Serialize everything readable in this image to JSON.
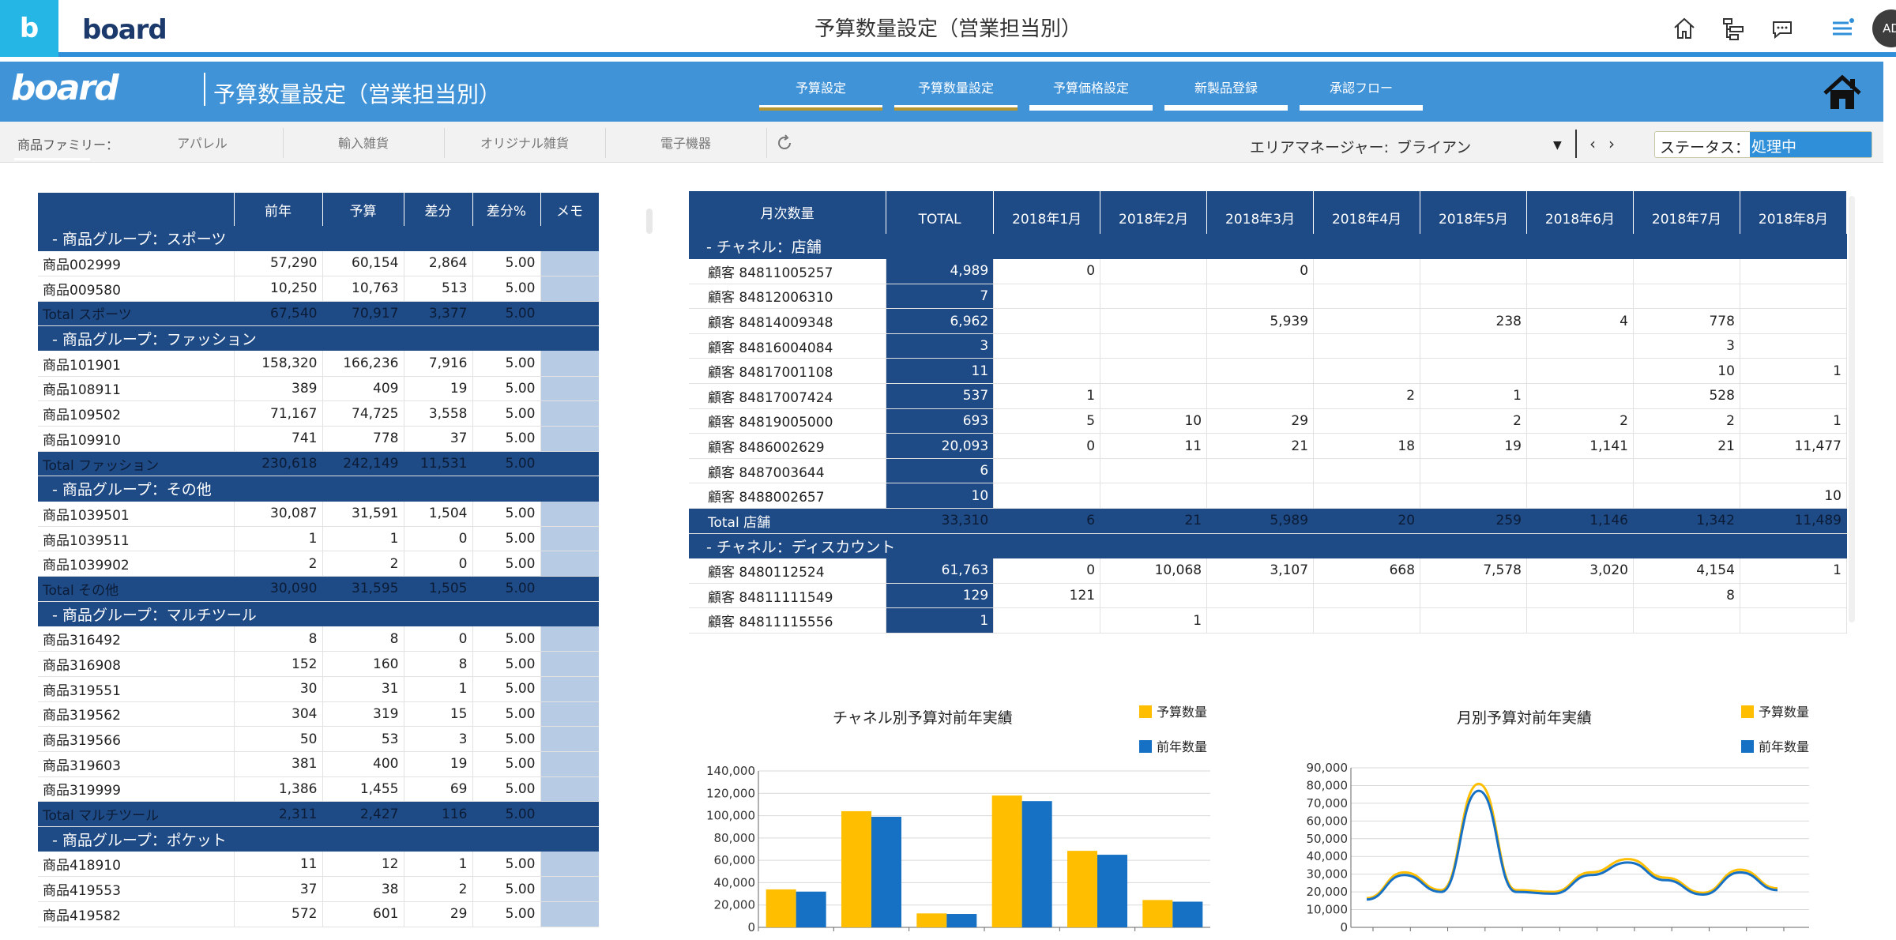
{
  "app": {
    "title": "予算数量設定（営業担当別）",
    "logo_text": "board",
    "tile_letter": "b",
    "avatar": "AD"
  },
  "header": {
    "page_title": "予算数量設定（営業担当別）",
    "logo_text": "board",
    "tabs": [
      {
        "label": "予算設定"
      },
      {
        "label": "予算数量設定"
      },
      {
        "label": "予算価格設定"
      },
      {
        "label": "新製品登録"
      },
      {
        "label": "承認フロー"
      }
    ]
  },
  "filters": {
    "family_label": "商品ファミリー：",
    "families": [
      "アパレル",
      "輸入雑貨",
      "オリジナル雑貨",
      "電子機器"
    ],
    "area_manager_label": "エリアマネージャー:",
    "area_manager_value": "ブライアン",
    "status_label": "ステータス：",
    "status_value": "処理中"
  },
  "left_grid": {
    "columns": [
      "",
      "前年",
      "予算",
      "差分",
      "差分%",
      "メモ"
    ],
    "rows": [
      {
        "type": "group",
        "label": "- 商品グループ：スポーツ"
      },
      {
        "type": "item",
        "cells": [
          "商品002999",
          "57,290",
          "60,154",
          "2,864",
          "5.00"
        ]
      },
      {
        "type": "item",
        "cells": [
          "商品009580",
          "10,250",
          "10,763",
          "513",
          "5.00"
        ]
      },
      {
        "type": "total",
        "cells": [
          "Total スポーツ",
          "67,540",
          "70,917",
          "3,377",
          "5.00"
        ]
      },
      {
        "type": "group",
        "label": "- 商品グループ：ファッション"
      },
      {
        "type": "item",
        "cells": [
          "商品101901",
          "158,320",
          "166,236",
          "7,916",
          "5.00"
        ]
      },
      {
        "type": "item",
        "cells": [
          "商品108911",
          "389",
          "409",
          "19",
          "5.00"
        ]
      },
      {
        "type": "item",
        "cells": [
          "商品109502",
          "71,167",
          "74,725",
          "3,558",
          "5.00"
        ]
      },
      {
        "type": "item",
        "cells": [
          "商品109910",
          "741",
          "778",
          "37",
          "5.00"
        ]
      },
      {
        "type": "total",
        "cells": [
          "Total ファッション",
          "230,618",
          "242,149",
          "11,531",
          "5.00"
        ]
      },
      {
        "type": "group",
        "label": "- 商品グループ：その他"
      },
      {
        "type": "item",
        "cells": [
          "商品1039501",
          "30,087",
          "31,591",
          "1,504",
          "5.00"
        ]
      },
      {
        "type": "item",
        "cells": [
          "商品1039511",
          "1",
          "1",
          "0",
          "5.00"
        ]
      },
      {
        "type": "item",
        "cells": [
          "商品1039902",
          "2",
          "2",
          "0",
          "5.00"
        ]
      },
      {
        "type": "total",
        "cells": [
          "Total その他",
          "30,090",
          "31,595",
          "1,505",
          "5.00"
        ]
      },
      {
        "type": "group",
        "label": "- 商品グループ：マルチツール"
      },
      {
        "type": "item",
        "cells": [
          "商品316492",
          "8",
          "8",
          "0",
          "5.00"
        ]
      },
      {
        "type": "item",
        "cells": [
          "商品316908",
          "152",
          "160",
          "8",
          "5.00"
        ]
      },
      {
        "type": "item",
        "cells": [
          "商品319551",
          "30",
          "31",
          "1",
          "5.00"
        ]
      },
      {
        "type": "item",
        "cells": [
          "商品319562",
          "304",
          "319",
          "15",
          "5.00"
        ]
      },
      {
        "type": "item",
        "cells": [
          "商品319566",
          "50",
          "53",
          "3",
          "5.00"
        ]
      },
      {
        "type": "item",
        "cells": [
          "商品319603",
          "381",
          "400",
          "19",
          "5.00"
        ]
      },
      {
        "type": "item",
        "cells": [
          "商品319999",
          "1,386",
          "1,455",
          "69",
          "5.00"
        ]
      },
      {
        "type": "total",
        "cells": [
          "Total マルチツール",
          "2,311",
          "2,427",
          "116",
          "5.00"
        ]
      },
      {
        "type": "group",
        "label": "- 商品グループ：ポケット"
      },
      {
        "type": "item",
        "cells": [
          "商品418910",
          "11",
          "12",
          "1",
          "5.00"
        ]
      },
      {
        "type": "item",
        "cells": [
          "商品419553",
          "37",
          "38",
          "2",
          "5.00"
        ]
      },
      {
        "type": "item",
        "cells": [
          "商品419582",
          "572",
          "601",
          "29",
          "5.00"
        ]
      }
    ]
  },
  "right_grid": {
    "columns": [
      "月次数量",
      "TOTAL",
      "2018年1月",
      "2018年2月",
      "2018年3月",
      "2018年4月",
      "2018年5月",
      "2018年6月",
      "2018年7月",
      "2018年8月"
    ],
    "rows": [
      {
        "type": "group",
        "label": "- チャネル：店舗"
      },
      {
        "type": "item",
        "cells": [
          "顧客 84811005257",
          "4,989",
          "0",
          "",
          "0",
          "",
          "",
          "",
          "",
          ""
        ]
      },
      {
        "type": "item",
        "cells": [
          "顧客 84812006310",
          "7",
          "",
          "",
          "",
          "",
          "",
          "",
          "",
          ""
        ]
      },
      {
        "type": "item",
        "cells": [
          "顧客 84814009348",
          "6,962",
          "",
          "",
          "5,939",
          "",
          "238",
          "4",
          "778",
          ""
        ]
      },
      {
        "type": "item",
        "cells": [
          "顧客 84816004084",
          "3",
          "",
          "",
          "",
          "",
          "",
          "",
          "3",
          ""
        ]
      },
      {
        "type": "item",
        "cells": [
          "顧客 84817001108",
          "11",
          "",
          "",
          "",
          "",
          "",
          "",
          "10",
          "1"
        ]
      },
      {
        "type": "item",
        "cells": [
          "顧客 84817007424",
          "537",
          "1",
          "",
          "",
          "2",
          "1",
          "",
          "528",
          ""
        ]
      },
      {
        "type": "item",
        "cells": [
          "顧客 84819005000",
          "693",
          "5",
          "10",
          "29",
          "",
          "2",
          "2",
          "2",
          "1"
        ]
      },
      {
        "type": "item",
        "cells": [
          "顧客 8486002629",
          "20,093",
          "0",
          "11",
          "21",
          "18",
          "19",
          "1,141",
          "21",
          "11,477"
        ]
      },
      {
        "type": "item",
        "cells": [
          "顧客 8487003644",
          "6",
          "",
          "",
          "",
          "",
          "",
          "",
          "",
          ""
        ]
      },
      {
        "type": "item",
        "cells": [
          "顧客 8488002657",
          "10",
          "",
          "",
          "",
          "",
          "",
          "",
          "",
          "10"
        ]
      },
      {
        "type": "total",
        "cells": [
          "Total 店舗",
          "33,310",
          "6",
          "21",
          "5,989",
          "20",
          "259",
          "1,146",
          "1,342",
          "11,489"
        ]
      },
      {
        "type": "group",
        "label": "- チャネル：ディスカウント"
      },
      {
        "type": "item",
        "cells": [
          "顧客 8480112524",
          "61,763",
          "0",
          "10,068",
          "3,107",
          "668",
          "7,578",
          "3,020",
          "4,154",
          "1"
        ]
      },
      {
        "type": "item",
        "cells": [
          "顧客 84811111549",
          "129",
          "121",
          "",
          "",
          "",
          "",
          "",
          "8",
          ""
        ]
      },
      {
        "type": "item",
        "cells": [
          "顧客 84811115556",
          "1",
          "",
          "1",
          "",
          "",
          "",
          "",
          "",
          ""
        ]
      }
    ]
  },
  "colors": {
    "budget": "#ffbf00",
    "prior": "#1670c4",
    "navy": "#1e4a85",
    "header_blue": "#4193d8"
  },
  "chart_data": [
    {
      "type": "bar",
      "title": "チャネル別予算対前年実績",
      "categories": [
        "",
        "",
        "",
        "",
        "",
        ""
      ],
      "series": [
        {
          "name": "予算数量",
          "values": [
            34000,
            104000,
            12500,
            118000,
            68500,
            24500
          ]
        },
        {
          "name": "前年数量",
          "values": [
            32000,
            99000,
            12000,
            113000,
            65000,
            23000
          ]
        }
      ],
      "ylim": [
        0,
        140000
      ],
      "yticks": [
        "0",
        "20,000",
        "40,000",
        "60,000",
        "80,000",
        "100,000",
        "120,000",
        "140,000"
      ],
      "legend": "top-right"
    },
    {
      "type": "line",
      "title": "月別予算対前年実績",
      "series": [
        {
          "name": "予算数量",
          "values": [
            16500,
            31000,
            21000,
            81000,
            21000,
            20000,
            31000,
            38500,
            28000,
            19500,
            32500,
            22000
          ]
        },
        {
          "name": "前年数量",
          "values": [
            15700,
            29500,
            20000,
            77000,
            20000,
            19000,
            29500,
            36600,
            26600,
            18500,
            31000,
            21000
          ]
        }
      ],
      "ylim": [
        0,
        90000
      ],
      "yticks": [
        "0",
        "10,000",
        "20,000",
        "30,000",
        "40,000",
        "50,000",
        "60,000",
        "70,000",
        "80,000",
        "90,000"
      ],
      "legend": "top-right"
    }
  ]
}
